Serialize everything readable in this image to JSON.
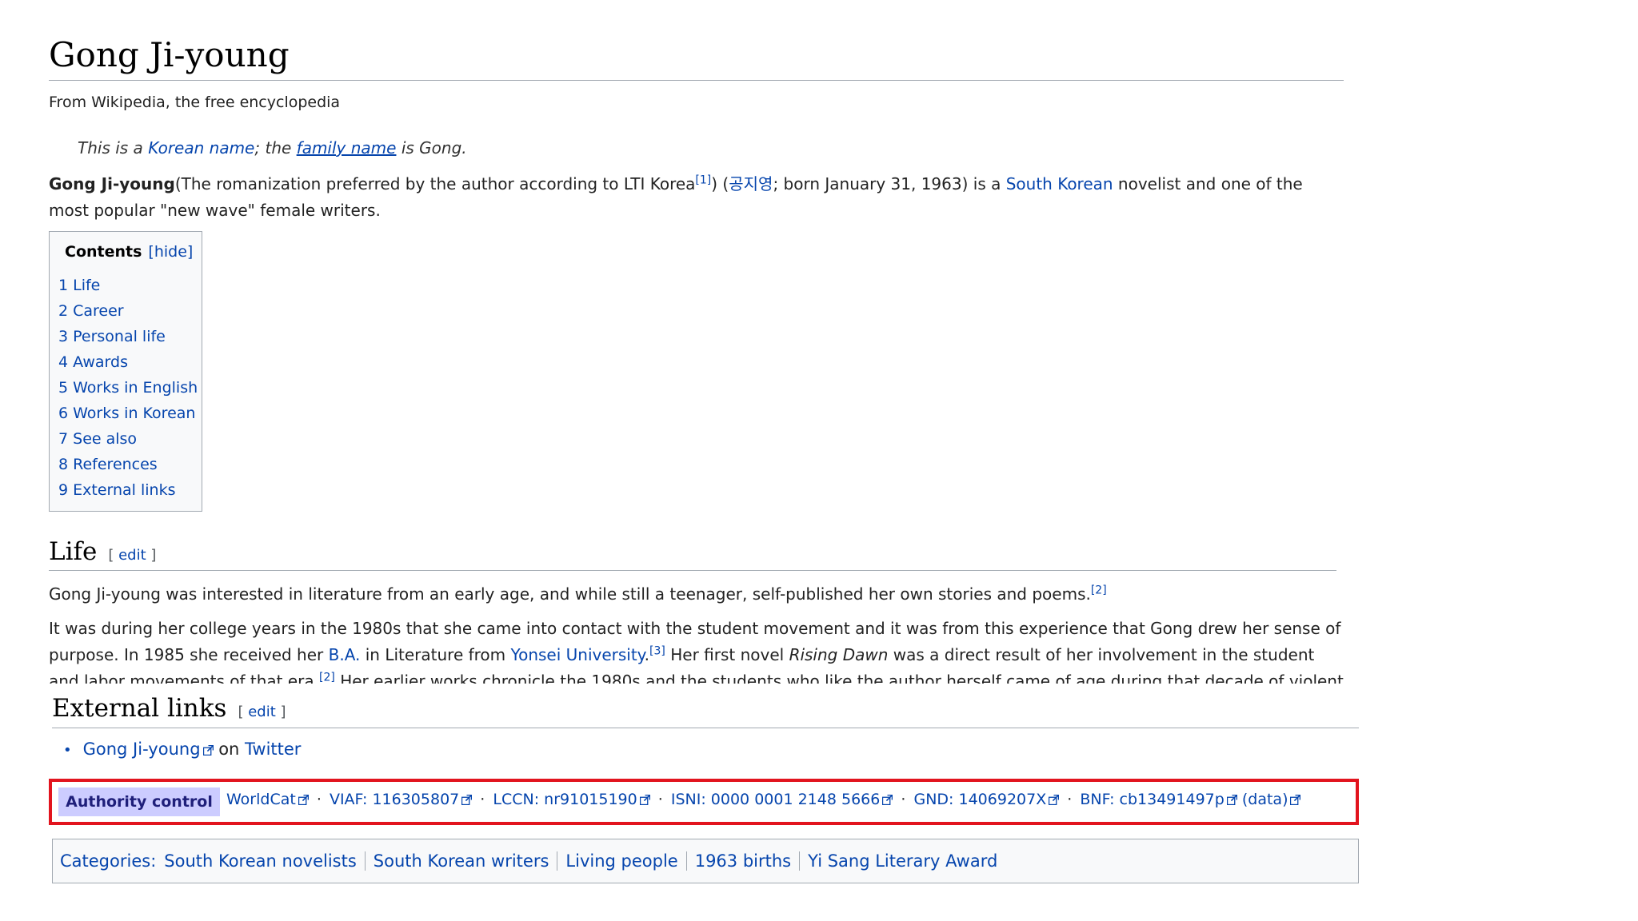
{
  "article": {
    "title": "Gong Ji-young",
    "tagline": "From Wikipedia, the free encyclopedia"
  },
  "hatnote": {
    "prefix": "This is a ",
    "korean_name": "Korean name",
    "middle": "; the ",
    "family_name": "family name",
    "suffix": " is Gong."
  },
  "intro": {
    "bold_name": "Gong Ji-young",
    "text1": "(The romanization preferred by the author according to LTI Korea",
    "ref1": "[1]",
    "text2": ") (",
    "hangul": "공지영",
    "text3": "; born January 31, 1963) is a ",
    "link_south_korean": "South Korean",
    "text4": " novelist and one of the most popular \"new wave\" female writers."
  },
  "toc": {
    "title": "Contents",
    "hide": "[hide]",
    "items": [
      {
        "label": "1 Life"
      },
      {
        "label": "2 Career"
      },
      {
        "label": "3 Personal life"
      },
      {
        "label": "4 Awards"
      },
      {
        "label": "5 Works in English"
      },
      {
        "label": "6 Works in Korean"
      },
      {
        "label": "7 See also"
      },
      {
        "label": "8 References"
      },
      {
        "label": "9 External links"
      }
    ]
  },
  "life": {
    "heading": "Life",
    "edit_open": "[ ",
    "edit": "edit",
    "edit_close": " ]",
    "p1_text": "Gong Ji-young was interested in literature from an early age, and while still a teenager, self-published her own stories and poems.",
    "p1_ref": "[2]",
    "p2_text1": "It was during her college years in the 1980s that she came into contact with the student movement and it was from this experience that Gong drew her sense of purpose. In 1985 she received her ",
    "p2_ba": "B.A.",
    "p2_text2": " in Literature from ",
    "p2_yonsei": "Yonsei University",
    "p2_ref3": "[3]",
    "p2_text3": " Her first novel ",
    "p2_novel": "Rising Dawn",
    "p2_text4": " was a direct result of her involvement in the student and labor movements of that era.",
    "p2_ref2": "[2]",
    "p2_text5": " Her earlier works chronicle the 1980s and the students who like the author herself came of age during that decade of violent protest"
  },
  "external": {
    "heading": "External links",
    "edit_open": "[ ",
    "edit": "edit",
    "edit_close": " ]",
    "twitter_name": "Gong Ji-young",
    "on": " on ",
    "twitter": "Twitter"
  },
  "authority": {
    "label": "Authority control",
    "items": [
      {
        "text": "WorldCat"
      },
      {
        "prefix": "VIAF: ",
        "text": "116305807"
      },
      {
        "prefix": "LCCN: ",
        "text": "nr91015190"
      },
      {
        "prefix": "ISNI: ",
        "text": "0000 0001 2148 5666"
      },
      {
        "prefix": "GND: ",
        "text": "14069207X"
      },
      {
        "prefix": "BNF: ",
        "text": "cb13491497p"
      },
      {
        "text": "(data)"
      }
    ],
    "separator": "·",
    "highlight_color": "#e2141e"
  },
  "categories": {
    "label": "Categories:",
    "items": [
      {
        "text": "South Korean novelists"
      },
      {
        "text": "South Korean writers"
      },
      {
        "text": "Living people"
      },
      {
        "text": "1963 births"
      },
      {
        "text": "Yi Sang Literary Award"
      }
    ]
  },
  "icons": {
    "external": "external-link-icon"
  }
}
